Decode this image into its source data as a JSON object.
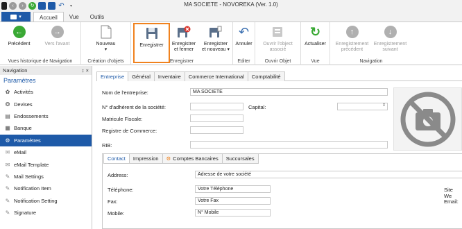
{
  "window": {
    "title": "MA SOCIETE - NOVOREKA (Ver. 1.0)"
  },
  "ribbon": {
    "tabs": [
      {
        "label": "Accueil",
        "active": true
      },
      {
        "label": "Vue",
        "active": false
      },
      {
        "label": "Outils",
        "active": false
      }
    ],
    "buttons": {
      "precedent": "Précédent",
      "vers_avant": "Vers l'avant",
      "nouveau": "Nouveau",
      "enregistrer": "Enregistrer",
      "enregistrer_fermer_1": "Enregistrer",
      "enregistrer_fermer_2": "et fermer",
      "enregistrer_nouveau_1": "Enregistrer",
      "enregistrer_nouveau_2": "et nouveau",
      "annuler": "Annuler",
      "ouvrir_1": "Ouvrir l'object",
      "ouvrir_2": "associé",
      "actualiser": "Actualiser",
      "enr_prec_1": "Enregistrement",
      "enr_prec_2": "précédent",
      "enr_suiv_1": "Enregistrement",
      "enr_suiv_2": "suivant"
    },
    "groups": {
      "historique": "Vues historique de Navigation",
      "creation": "Création d'objets",
      "enregistrer": "Enregistrer",
      "editer": "Editer",
      "ouvrir": "Ouvrir Objet",
      "vue": "Vue",
      "navigation": "Navigation"
    }
  },
  "nav": {
    "header": "Navigation",
    "pin": "↕ ×",
    "title": "Paramètres",
    "items": [
      {
        "label": "Activités",
        "icon": "activities-icon"
      },
      {
        "label": "Devises",
        "icon": "currency-icon"
      },
      {
        "label": "Endossements",
        "icon": "endorsement-icon"
      },
      {
        "label": "Banque",
        "icon": "bank-icon"
      },
      {
        "label": "Paramètres",
        "icon": "gear-icon",
        "selected": true
      },
      {
        "label": "eMail",
        "icon": "email-icon"
      },
      {
        "label": "eMail Template",
        "icon": "email-template-icon"
      },
      {
        "label": "Mail Settings",
        "icon": "mail-settings-icon"
      },
      {
        "label": "Notification Item",
        "icon": "notification-icon"
      },
      {
        "label": "Notification Setting",
        "icon": "notification-setting-icon"
      },
      {
        "label": "Signature",
        "icon": "signature-icon"
      }
    ]
  },
  "form": {
    "tabs": [
      "Entreprise",
      "Général",
      "Inventaire",
      "Commerce International",
      "Comptabilité"
    ],
    "nom_label": "Nom de l'entreprise:",
    "nom_value": "MA SOCIETE",
    "adherent_label": "N° d'adhérent de la société:",
    "capital_label": "Capital:",
    "matricule_label": "Matricule Fiscale:",
    "registre_label": "Registre de Commerce:",
    "rib_label": "RIB:",
    "subtabs": [
      "Contact",
      "Impression",
      "Comptes Bancaires",
      "Succursales"
    ],
    "address_label": "Address:",
    "address_placeholder": "Adresse de votre société",
    "telephone_label": "Téléphone:",
    "telephone_placeholder": "Votre Téléphone",
    "fax_label": "Fax:",
    "fax_placeholder": "Votre Fax",
    "mobile_label": "Mobile:",
    "mobile_placeholder": "N° Mobile",
    "site_label": "Site We",
    "email_label": "Email:"
  },
  "colors": {
    "accent": "#1e5aa8",
    "highlight": "#f0821e",
    "green": "#3aa935"
  }
}
